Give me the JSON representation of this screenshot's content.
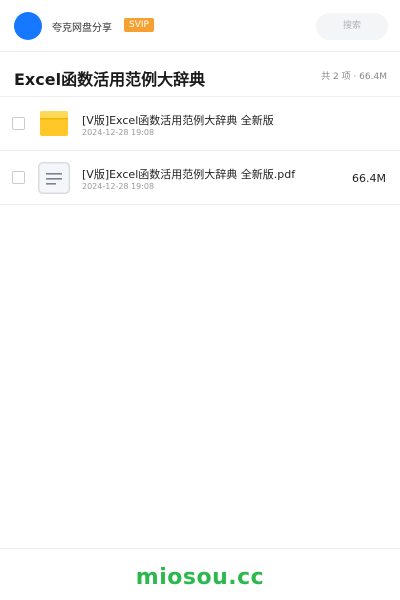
{
  "header": {
    "brand_name": "夸克网盘分享",
    "vip_badge": "SVIP",
    "search_label": "搜索"
  },
  "share": {
    "title": "Excel函数活用范例大辞典",
    "summary": "共 2 项 · 66.4M"
  },
  "files": [
    {
      "name": "[V版]Excel函数活用范例大辞典 全新版",
      "date": "2024-12-28 19:08",
      "size": "",
      "icon": "folder-icon"
    },
    {
      "name": "[V版]Excel函数活用范例大辞典 全新版.pdf",
      "date": "2024-12-28 19:08",
      "size": "66.4M",
      "icon": "document-icon"
    }
  ],
  "footer": {
    "watermark": "miosou.cc"
  },
  "colors": {
    "avatar": "#1677ff",
    "vip_badge": "#f5a031",
    "folder": "#ffc728",
    "watermark": "#2db84d"
  }
}
